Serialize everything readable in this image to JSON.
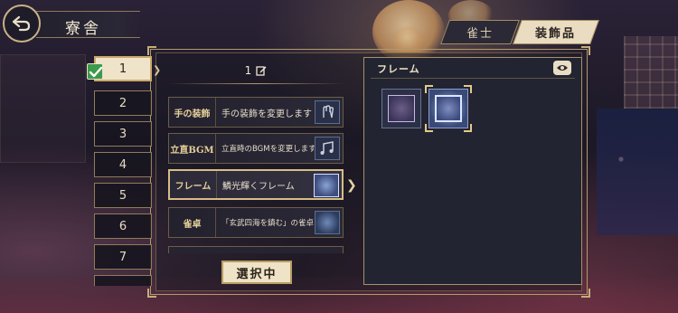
{
  "header": {
    "title": "寮舎"
  },
  "tabs": [
    {
      "label": "雀士",
      "active": false
    },
    {
      "label": "装飾品",
      "active": true
    }
  ],
  "loadouts": {
    "items": [
      "1",
      "2",
      "3",
      "4",
      "5",
      "6",
      "7"
    ],
    "selected_index": 0,
    "selected_checked": true
  },
  "loadout_name": {
    "value": "1",
    "edit_icon": "edit-icon"
  },
  "slots": [
    {
      "label": "手の装飾",
      "value": "手の装飾を変更します",
      "icon": "hand-icon"
    },
    {
      "label": "立直BGM",
      "value": "立直時のBGMを変更します",
      "icon": "music-note-icon"
    },
    {
      "label": "フレーム",
      "value": "鱗光輝くフレーム",
      "icon": "frame-icon"
    },
    {
      "label": "雀卓",
      "value": "「玄武四海を鎮む」の雀卓",
      "icon": "table-icon"
    }
  ],
  "active_slot_index": 2,
  "in_use_button": {
    "label": "選択中"
  },
  "selection_panel": {
    "title": "フレーム",
    "preview_icon": "eye-icon",
    "options": [
      {
        "name": "default-frame",
        "selected": false
      },
      {
        "name": "shimmering-scale-frame",
        "selected": true
      }
    ]
  },
  "colors": {
    "accent_gold": "#c9a96a",
    "panel_bg": "#222432",
    "selected_bg": "#efe4c9",
    "check_green": "#3c9a4a"
  }
}
